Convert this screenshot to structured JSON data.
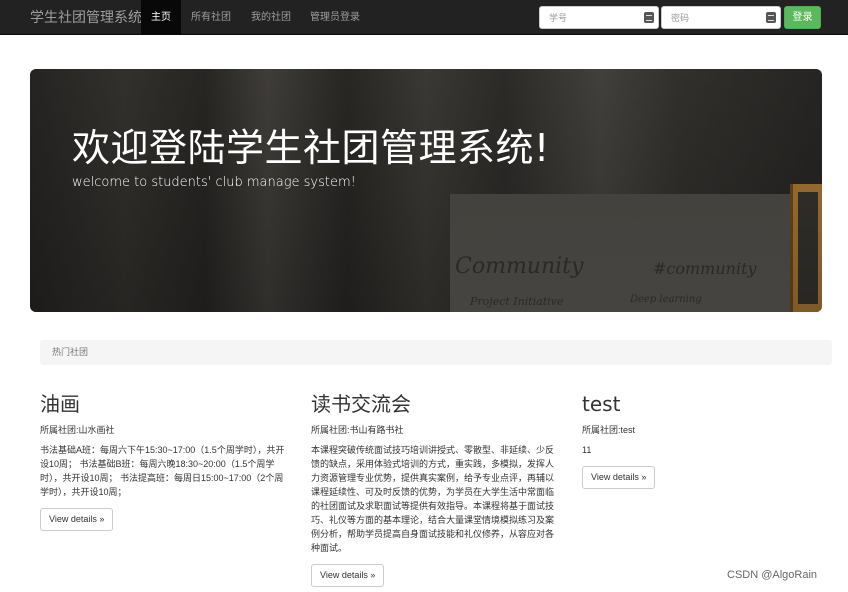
{
  "navbar": {
    "brand": "学生社团管理系统",
    "items": [
      {
        "label": "主页"
      },
      {
        "label": "所有社团"
      },
      {
        "label": "我的社团"
      },
      {
        "label": "管理员登录"
      }
    ],
    "student_id_placeholder": "学号",
    "password_placeholder": "密码",
    "login_label": "登录"
  },
  "hero": {
    "title": "欢迎登陆学生社团管理系统!",
    "subtitle": "welcome to students' club manage system!",
    "board_writing": [
      "Community",
      "#community",
      "Project Initiative",
      "Deep learning"
    ]
  },
  "section": {
    "title": "热门社团"
  },
  "clubs": [
    {
      "name": "油画",
      "owner": "所属社团:山水画社",
      "desc": "书法基础A班：每周六下午15:30~17:00（1.5个周学时），共开设10周； 书法基础B班：每周六晚18:30~20:00（1.5个周学时），共开设10周； 书法提高班：每周日15:00~17:00（2个周学时），共开设10周；",
      "button": "View details »"
    },
    {
      "name": "读书交流会",
      "owner": "所属社团:书山有路书社",
      "desc": "本课程突破传统面试技巧培训讲授式、零散型、非延续、少反馈的缺点，采用体验式培训的方式，重实践，多模拟，发挥人力资源管理专业优势，提供真实案例，给予专业点评，再辅以课程延续性、可及时反馈的优势，为学员在大学生活中常面临的社团面试及求职面试等提供有效指导。本课程将基于面试技巧、礼仪等方面的基本理论，结合大量课堂情境模拟练习及案例分析，帮助学员提高自身面试技能和礼仪修养，从容应对各种面试。",
      "button": "View details »"
    },
    {
      "name": "test",
      "owner": "所属社团:test",
      "desc": "11",
      "button": "View details »"
    }
  ],
  "watermark": "CSDN @AlgoRain",
  "colors": {
    "navbar": "#222222",
    "login_button": "#5cb85c",
    "section_bar": "#f5f5f5"
  }
}
